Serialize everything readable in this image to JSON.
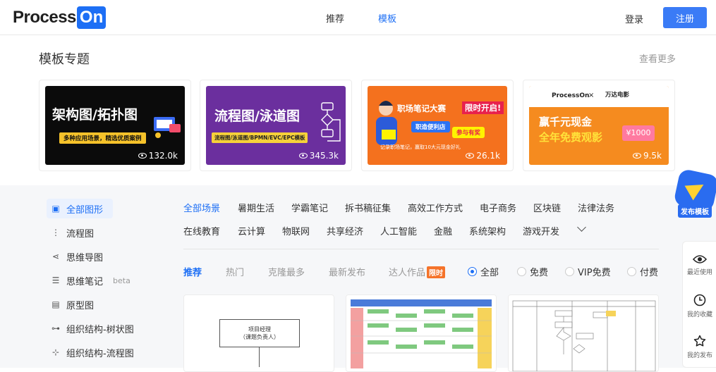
{
  "header": {
    "logo_text": "Process",
    "logo_box": "On",
    "nav": [
      {
        "label": "推荐"
      },
      {
        "label": "模板"
      }
    ],
    "login_label": "登录",
    "register_label": "注册"
  },
  "topics": {
    "title": "模板专题",
    "see_more": "查看更多",
    "cards": [
      {
        "headline": "架构图/拓扑图",
        "subline": "多种应用场景，精选优质案例",
        "views": "132.0k"
      },
      {
        "headline": "流程图/泳道图",
        "subline": "流程图/泳道图/BPMN/EVC/EPC模板",
        "views": "345.3k"
      },
      {
        "headline": "职场笔记大赛",
        "badge": "限时开启!",
        "chip1": "职造便利店",
        "chip2": "参与有奖",
        "desc": "记录职场笔记，赢取10大元现金好礼",
        "views": "26.1k"
      },
      {
        "brand_left": "ProcessOn",
        "brand_x": "×",
        "brand_right": "万达电影",
        "headline1": "赢千元现金",
        "headline2": "全年免费观影",
        "ticket": "¥1000",
        "views": "9.5k"
      }
    ]
  },
  "sidebar": {
    "items": [
      {
        "label": "全部图形",
        "icon": "shapes-icon",
        "active": true
      },
      {
        "label": "流程图",
        "icon": "flowchart-icon"
      },
      {
        "label": "思维导图",
        "icon": "mindmap-icon"
      },
      {
        "label": "思维笔记",
        "icon": "list-icon",
        "tag": "beta"
      },
      {
        "label": "原型图",
        "icon": "prototype-icon"
      },
      {
        "label": "组织结构-树状图",
        "icon": "org-tree-icon"
      },
      {
        "label": "组织结构-流程图",
        "icon": "org-flow-icon"
      }
    ]
  },
  "scenes": {
    "row1": [
      "全部场景",
      "暑期生活",
      "学霸笔记",
      "拆书稿征集",
      "高效工作方式",
      "电子商务",
      "区块链",
      "法律法务"
    ],
    "row2": [
      "在线教育",
      "云计算",
      "物联网",
      "共享经济",
      "人工智能",
      "金融",
      "系统架构",
      "游戏开发"
    ]
  },
  "sort": {
    "tabs": [
      "推荐",
      "热门",
      "克隆最多",
      "最新发布",
      "达人作品"
    ],
    "limited_badge": "限时",
    "filters": [
      "全部",
      "免费",
      "VIP免费",
      "付费"
    ]
  },
  "tiles": {
    "t1_box": "项目经理\n（课题负责人）"
  },
  "floating": {
    "publish_label": "发布模板",
    "items": [
      {
        "label": "最近使用",
        "icon": "eye-icon"
      },
      {
        "label": "我的收藏",
        "icon": "clock-icon"
      },
      {
        "label": "我的发布",
        "icon": "star-icon"
      }
    ]
  },
  "colors": {
    "accent": "#1d6ff5",
    "register": "#3a7bf6",
    "grey_bg": "#f6f7f9"
  }
}
